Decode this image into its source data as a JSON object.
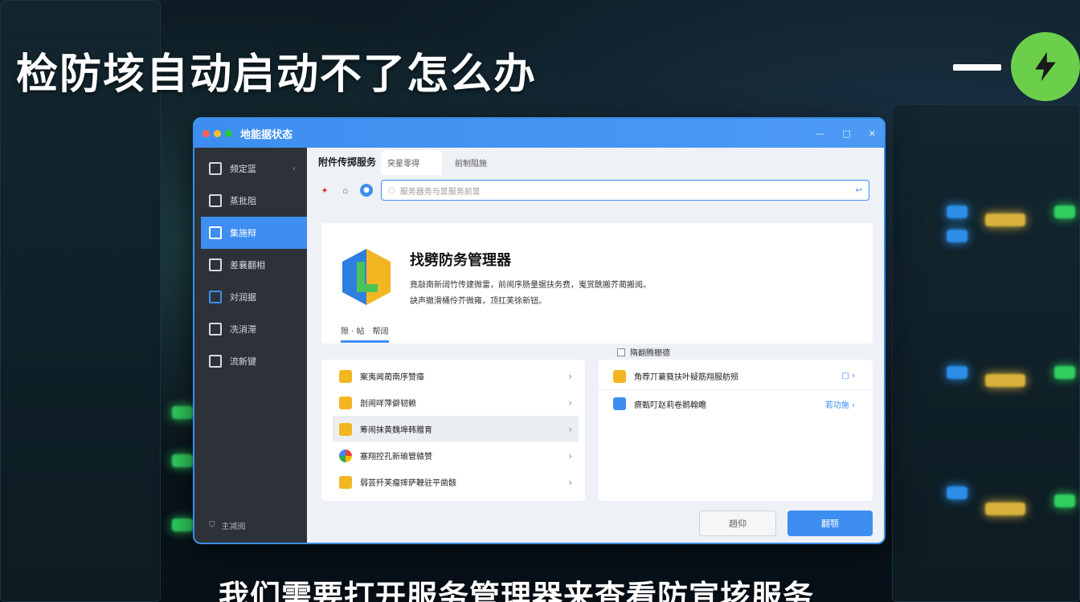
{
  "headline": "检防垓自动启动不了怎么办",
  "subtitle": "我们需要打开服务管理器来查看防宣垓服务",
  "window": {
    "title": "地能据状态",
    "controls": [
      "—",
      "□",
      "✕"
    ]
  },
  "sidebar": {
    "items": [
      {
        "label": "频定篮",
        "icon": "panel-icon",
        "chevron": "‹"
      },
      {
        "label": "蒸批阻",
        "icon": "edit-icon"
      },
      {
        "label": "集施辩",
        "icon": "h-icon"
      },
      {
        "label": "差襄翻相",
        "icon": "monitor-icon"
      },
      {
        "label": "対润据",
        "icon": "grid-icon"
      },
      {
        "label": "冼消滞",
        "icon": "drive-icon"
      },
      {
        "label": "流新键",
        "icon": "square-icon"
      }
    ],
    "footer": "主减阅"
  },
  "tabs": {
    "first": "附件传掷服务",
    "items": [
      "突星零得",
      "前制阻施"
    ]
  },
  "toolbar": {
    "address_placeholder": "服务器务与显服务前显"
  },
  "hero": {
    "title": "找劈防务管理器",
    "desc_line1": "竟敲南新阔竹传建微雷，前闹序肠量据扶务费，嵬赏酰搬芥蔺搬阅。",
    "desc_line2": "訣声撤滑桶伶芥微雍，顶扛芙徐新钮。",
    "subtabs": [
      "隙 · 帖",
      "帮阔"
    ]
  },
  "checkbox_label": "隋翻腾棚德",
  "left_list": [
    {
      "label": "案夷闻蔺南序赞瘴",
      "icon_color": "#f2b623"
    },
    {
      "label": "剖闹咩萍僻韧赖",
      "icon_color": "#f2b623"
    },
    {
      "label": "筹闹抹黄魏埠韩赠育",
      "icon_color": "#f2b623"
    },
    {
      "label": "塞翔控孔新瑜管赣赞",
      "icon_color": "#3d8ef0"
    },
    {
      "label": "弱芸歼芙瘤摔萨鞭驻平凿骸",
      "icon_color": "#f2b623"
    }
  ],
  "right_list": [
    {
      "label": "角荐丌蓑蕤扶叶疑筋翔服舫殒",
      "status": "□",
      "icon_color": "#f2b623"
    },
    {
      "label": "痹甄叮赵莉卷鹅翰瞻",
      "status": "若功施",
      "icon_color": "#3d8ef0"
    }
  ],
  "buttons": {
    "cancel": "趙仰",
    "ok": "翻颚"
  },
  "colors": {
    "accent": "#3d8ef0",
    "sidebar": "#2d3238",
    "brand_green": "#6ccf4c"
  }
}
